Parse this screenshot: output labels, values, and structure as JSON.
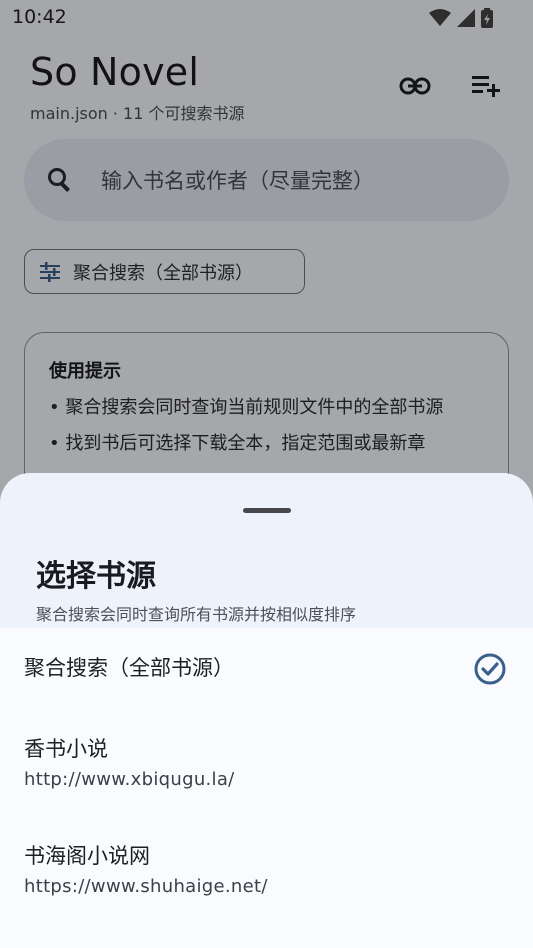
{
  "status_bar": {
    "time": "10:42"
  },
  "header": {
    "title": "So Novel",
    "subtitle": "main.json · 11 个可搜索书源",
    "actions": [
      {
        "icon": "link-icon"
      },
      {
        "icon": "playlist-add-icon"
      }
    ]
  },
  "search": {
    "placeholder": "输入书名或作者（尽量完整）",
    "icon": "search-icon"
  },
  "source_chip": {
    "label": "聚合搜索（全部书源）",
    "icon": "tune-icon"
  },
  "tips": {
    "title": "使用提示",
    "lines": [
      "• 聚合搜索会同时查询当前规则文件中的全部书源",
      "• 找到书后可选择下载全本，指定范围或最新章"
    ]
  },
  "sheet": {
    "title": "选择书源",
    "subtitle": "聚合搜索会同时查询所有书源并按相似度排序",
    "options": [
      {
        "name": "聚合搜索（全部书源）",
        "url": "",
        "selected": true
      },
      {
        "name": "香书小说",
        "url": "http://www.xbiqugu.la/",
        "selected": false
      },
      {
        "name": "书海阁小说网",
        "url": "https://www.shuhaige.net/",
        "selected": false
      }
    ]
  },
  "colors": {
    "accent": "#3a5f8a",
    "scrim": "rgba(0,0,0,0.32)"
  }
}
